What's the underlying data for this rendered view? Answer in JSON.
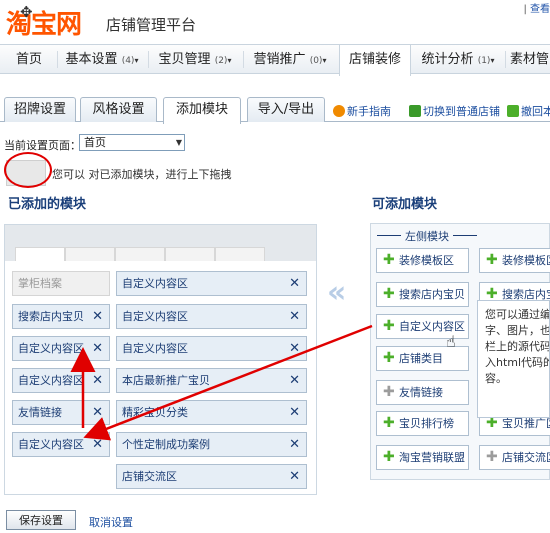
{
  "header": {
    "logo": "淘宝网",
    "platform": "店铺管理平台",
    "top_right_prefix": "| ",
    "top_right_link": "查看"
  },
  "mainnav": [
    {
      "label": "首页",
      "count": "",
      "caret": ""
    },
    {
      "label": "基本设置",
      "count": "(4)",
      "caret": "▾"
    },
    {
      "label": "宝贝管理",
      "count": "(2)",
      "caret": "▾"
    },
    {
      "label": "营销推广",
      "count": "(0)",
      "caret": "▾"
    },
    {
      "label": "店铺装修",
      "count": "",
      "caret": ""
    },
    {
      "label": "统计分析",
      "count": "(1)",
      "caret": "▾"
    },
    {
      "label": "素材管",
      "count": "",
      "caret": ""
    }
  ],
  "subtabs": [
    {
      "label": "招牌设置"
    },
    {
      "label": "风格设置"
    },
    {
      "label": "添加模块"
    },
    {
      "label": "导入/导出"
    }
  ],
  "sublinks": [
    {
      "label": "新手指南",
      "color": "#f08a00"
    },
    {
      "label": "切换到普通店铺",
      "color": "#3a9a2a"
    },
    {
      "label": "撤回本",
      "color": "#4caf2a"
    }
  ],
  "page_select": {
    "label": "当前设置页面：",
    "value": "首页"
  },
  "drag_hint": "您可以 对已添加模块，进行上下拖拽",
  "added_title": "已添加的模块",
  "available_title": "可添加模块",
  "left_column": [
    {
      "label": "掌柜档案",
      "disabled": true
    },
    {
      "label": "搜索店内宝贝",
      "disabled": false
    },
    {
      "label": "自定义内容区",
      "disabled": false
    },
    {
      "label": "自定义内容区",
      "disabled": false
    },
    {
      "label": "友情链接",
      "disabled": false
    },
    {
      "label": "自定义内容区",
      "disabled": false
    }
  ],
  "right_column": [
    {
      "label": "自定义内容区"
    },
    {
      "label": "自定义内容区"
    },
    {
      "label": "自定义内容区"
    },
    {
      "label": "本店最新推广宝贝"
    },
    {
      "label": "精彩宝贝分类"
    },
    {
      "label": "个性定制成功案例"
    },
    {
      "label": "店铺交流区"
    }
  ],
  "available": {
    "header": "左侧模块",
    "col1": [
      {
        "label": "装修模板区",
        "enabled": true
      },
      {
        "label": "搜索店内宝贝",
        "enabled": true
      },
      {
        "label": "自定义内容区",
        "enabled": true
      },
      {
        "label": "店铺类目",
        "enabled": true
      },
      {
        "label": "友情链接",
        "enabled": false
      },
      {
        "label": "宝贝排行榜",
        "enabled": true
      },
      {
        "label": "淘宝营销联盟",
        "enabled": true
      }
    ],
    "col2": [
      {
        "label": "装修模板区",
        "enabled": true
      },
      {
        "label": "搜索店内宝",
        "enabled": true
      },
      {
        "label": "宝贝推广区",
        "enabled": true
      },
      {
        "label": "店铺交流区",
        "enabled": false
      }
    ]
  },
  "tooltip_lines": [
    "您可以通过编",
    "字、图片，也",
    "栏上的源代码",
    "入html代码的",
    "容。"
  ],
  "footer": {
    "save": "保存设置",
    "cancel": "取消设置"
  },
  "colors": {
    "brand": "#ff5500",
    "link": "#1d4fa0",
    "annotation": "#e00000",
    "module_bg": "#e6eef6"
  }
}
